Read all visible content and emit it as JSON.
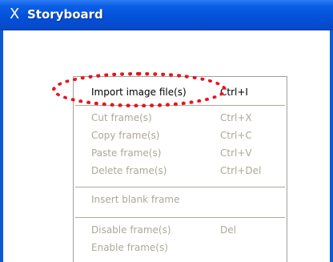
{
  "window": {
    "title": "Storyboard",
    "icon": "storyboard-icon"
  },
  "context_menu": {
    "items": [
      {
        "label": "Import image file(s)",
        "shortcut": "Ctrl+I",
        "enabled": true
      },
      {
        "label": "Cut frame(s)",
        "shortcut": "Ctrl+X",
        "enabled": false
      },
      {
        "label": "Copy frame(s)",
        "shortcut": "Ctrl+C",
        "enabled": false
      },
      {
        "label": "Paste frame(s)",
        "shortcut": "Ctrl+V",
        "enabled": false
      },
      {
        "label": "Delete frame(s)",
        "shortcut": "Ctrl+Del",
        "enabled": false
      },
      {
        "label": "Insert blank frame",
        "shortcut": "",
        "enabled": false
      },
      {
        "label": "Disable frame(s)",
        "shortcut": "Del",
        "enabled": false
      },
      {
        "label": "Enable frame(s)",
        "shortcut": "",
        "enabled": false
      }
    ]
  },
  "colors": {
    "titlebar": "#0250d8",
    "highlight": "#e8141c",
    "disabled_text": "#aca899"
  }
}
